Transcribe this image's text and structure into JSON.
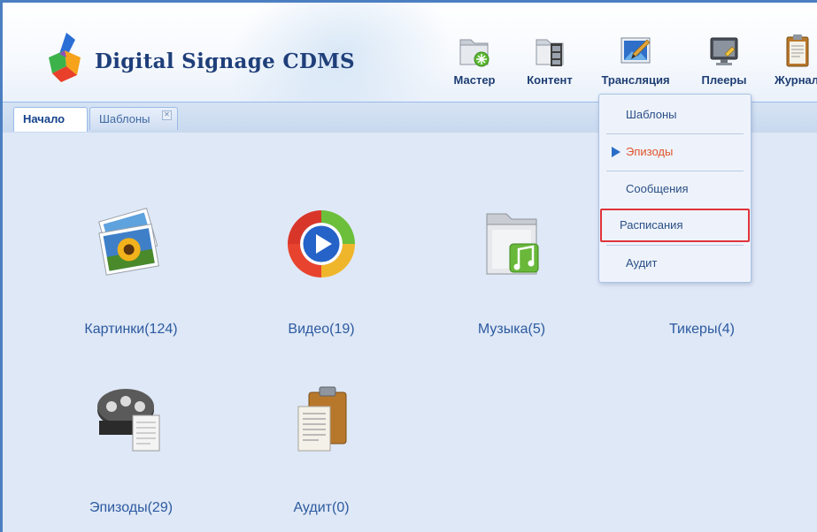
{
  "app": {
    "title": "Digital Signage CDMS"
  },
  "nav": [
    {
      "label": "Мастер",
      "icon": "wizard-folder-icon"
    },
    {
      "label": "Контент",
      "icon": "content-film-icon"
    },
    {
      "label": "Трансляция",
      "icon": "broadcast-picture-icon"
    },
    {
      "label": "Плееры",
      "icon": "players-monitor-icon"
    },
    {
      "label": "Журнал",
      "icon": "journal-clipboard-icon"
    }
  ],
  "tabs": [
    {
      "label": "Начало",
      "active": true
    },
    {
      "label": "Шаблоны",
      "active": false,
      "closable": true
    }
  ],
  "tiles": [
    {
      "label": "Картинки(124)",
      "icon": "pictures-icon"
    },
    {
      "label": "Видео(19)",
      "icon": "video-play-icon"
    },
    {
      "label": "Музыка(5)",
      "icon": "music-folder-icon"
    },
    {
      "label": "Тикеры(4)",
      "icon": "tickers-icon"
    },
    {
      "label": "Эпизоды(29)",
      "icon": "episodes-film-reel-icon"
    },
    {
      "label": "Аудит(0)",
      "icon": "audit-clipboard-icon"
    }
  ],
  "dropdown": {
    "items": [
      {
        "label": "Шаблоны"
      },
      {
        "label": "Эпизоды",
        "current": true
      },
      {
        "label": "Сообщения"
      },
      {
        "label": "Расписания",
        "highlighted": true
      },
      {
        "label": "Аудит"
      }
    ]
  },
  "colors": {
    "accent": "#2c5aa0",
    "background": "#dfe8f6",
    "active_menu": "#e0542b",
    "highlight_border": "#e0333b"
  }
}
